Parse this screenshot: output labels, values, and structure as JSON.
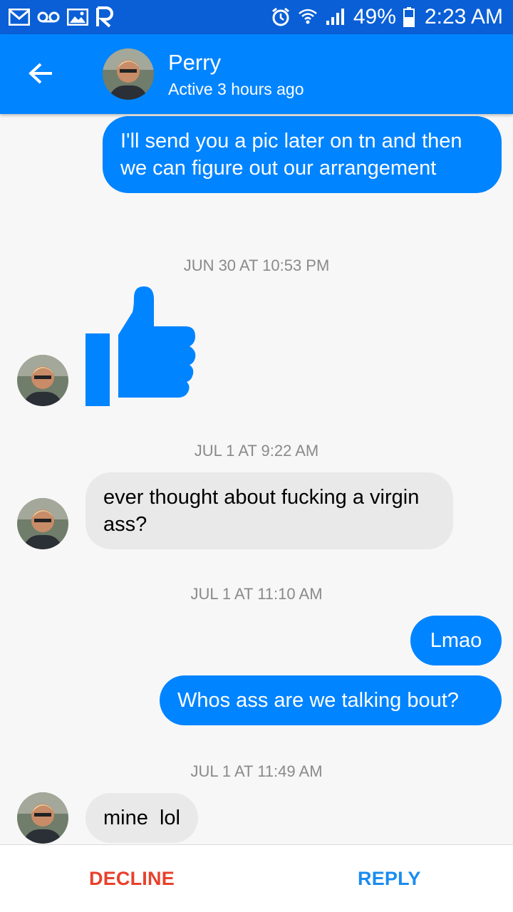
{
  "status_bar": {
    "battery_percent": "49%",
    "time": "2:23 AM",
    "icons": [
      "gmail-icon",
      "voicemail-icon",
      "gallery-icon",
      "r-app-icon",
      "alarm-icon",
      "wifi-icon",
      "signal-icon",
      "battery-icon"
    ]
  },
  "header": {
    "contact_name": "Perry",
    "active_status": "Active 3 hours ago"
  },
  "messages": [
    {
      "direction": "outgoing",
      "text": "I'll send you a pic later on tn and then we can figure out our arrangement"
    },
    {
      "type": "timestamp",
      "text": "JUN 30 AT 10:53 PM"
    },
    {
      "direction": "incoming",
      "type": "like-sticker"
    },
    {
      "type": "timestamp",
      "text": "JUL 1 AT 9:22 AM"
    },
    {
      "direction": "incoming",
      "text": "ever thought about fucking a virgin ass?"
    },
    {
      "type": "timestamp",
      "text": "JUL 1 AT 11:10 AM"
    },
    {
      "direction": "outgoing",
      "text": "Lmao"
    },
    {
      "direction": "outgoing",
      "text": "Whos ass are we talking bout?"
    },
    {
      "type": "timestamp",
      "text": "JUL 1 AT 11:49 AM"
    },
    {
      "direction": "incoming",
      "text": "mine  lol"
    }
  ],
  "actions": {
    "decline_label": "DECLINE",
    "reply_label": "REPLY"
  },
  "colors": {
    "status_bar": "#0a5fd6",
    "header": "#0084ff",
    "outgoing_bubble": "#0084ff",
    "incoming_bubble": "#e9e9e9",
    "decline": "#e8412c",
    "reply": "#1a8cf0"
  }
}
